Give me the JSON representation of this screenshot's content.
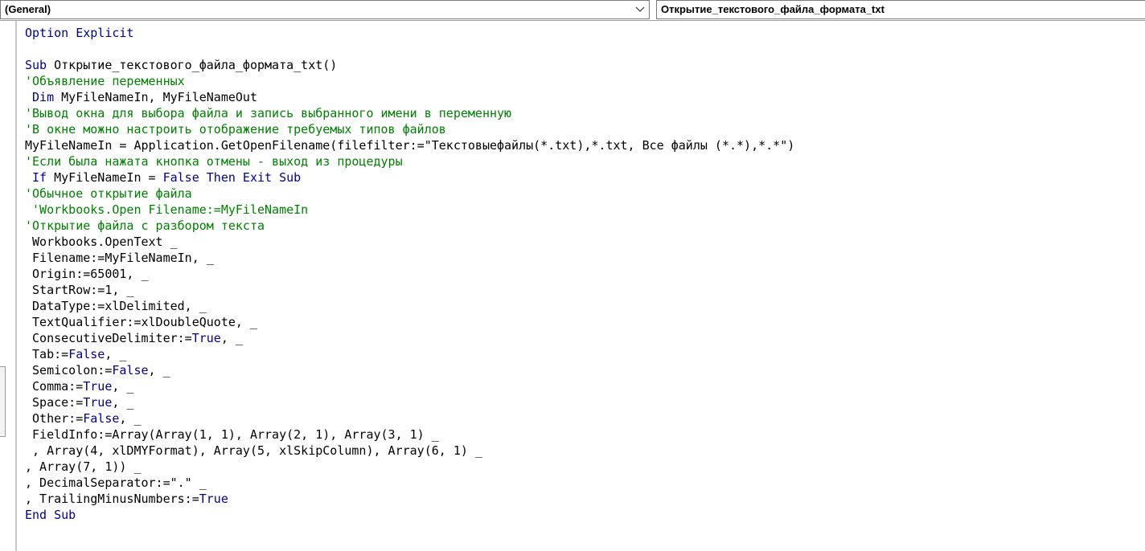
{
  "object_combo": {
    "selected": "(General)"
  },
  "procedure_combo": {
    "selected": "Открытие_текстового_файла_формата_txt"
  },
  "icons": {
    "dropdown": "chevron-down-icon"
  },
  "colors": {
    "keyword": "#00008b",
    "comment": "#008000",
    "text": "#000000"
  },
  "code_lines": [
    [
      {
        "t": "kw",
        "s": "Option Explicit"
      }
    ],
    [],
    [
      {
        "t": "kw",
        "s": "Sub"
      },
      {
        "t": "tx",
        "s": " Открытие_текстового_файла_формата_txt()"
      }
    ],
    [
      {
        "t": "cm",
        "s": "'Объявление переменных"
      }
    ],
    [
      {
        "t": "kw",
        "s": " Dim"
      },
      {
        "t": "tx",
        "s": " MyFileNameIn, MyFileNameOut"
      }
    ],
    [
      {
        "t": "cm",
        "s": "'Вывод окна для выбора файла и запись выбранного имени в переменную"
      }
    ],
    [
      {
        "t": "cm",
        "s": "'В окне можно настроить отображение требуемых типов файлов"
      }
    ],
    [
      {
        "t": "tx",
        "s": "MyFileNameIn = Application.GetOpenFilename(filefilter:=\"Текстовыефайлы(*.txt),*.txt, Все файлы (*.*),*.*\")"
      }
    ],
    [
      {
        "t": "cm",
        "s": "'Если была нажата кнопка отмены - выход из процедуры"
      }
    ],
    [
      {
        "t": "kw",
        "s": " If"
      },
      {
        "t": "tx",
        "s": " MyFileNameIn = "
      },
      {
        "t": "kw",
        "s": "False Then Exit Sub"
      }
    ],
    [
      {
        "t": "cm",
        "s": "'Обычное открытие файла"
      }
    ],
    [
      {
        "t": "cm",
        "s": " 'Workbooks.Open Filename:=MyFileNameIn"
      }
    ],
    [
      {
        "t": "cm",
        "s": "'Открытие файла с разбором текста"
      }
    ],
    [
      {
        "t": "tx",
        "s": " Workbooks.OpenText _"
      }
    ],
    [
      {
        "t": "tx",
        "s": " Filename:=MyFileNameIn, _"
      }
    ],
    [
      {
        "t": "tx",
        "s": " Origin:=65001, _"
      }
    ],
    [
      {
        "t": "tx",
        "s": " StartRow:=1, _"
      }
    ],
    [
      {
        "t": "tx",
        "s": " DataType:=xlDelimited, _"
      }
    ],
    [
      {
        "t": "tx",
        "s": " TextQualifier:=xlDoubleQuote, _"
      }
    ],
    [
      {
        "t": "tx",
        "s": " ConsecutiveDelimiter:="
      },
      {
        "t": "kw",
        "s": "True"
      },
      {
        "t": "tx",
        "s": ", _"
      }
    ],
    [
      {
        "t": "tx",
        "s": " Tab:="
      },
      {
        "t": "kw",
        "s": "False"
      },
      {
        "t": "tx",
        "s": ", _"
      }
    ],
    [
      {
        "t": "tx",
        "s": " Semicolon:="
      },
      {
        "t": "kw",
        "s": "False"
      },
      {
        "t": "tx",
        "s": ", _"
      }
    ],
    [
      {
        "t": "tx",
        "s": " Comma:="
      },
      {
        "t": "kw",
        "s": "True"
      },
      {
        "t": "tx",
        "s": ", _"
      }
    ],
    [
      {
        "t": "tx",
        "s": " Space:="
      },
      {
        "t": "kw",
        "s": "True"
      },
      {
        "t": "tx",
        "s": ", _"
      }
    ],
    [
      {
        "t": "tx",
        "s": " Other:="
      },
      {
        "t": "kw",
        "s": "False"
      },
      {
        "t": "tx",
        "s": ", _"
      }
    ],
    [
      {
        "t": "tx",
        "s": " FieldInfo:=Array(Array(1, 1), Array(2, 1), Array(3, 1) _"
      }
    ],
    [
      {
        "t": "tx",
        "s": " , Array(4, xlDMYFormat), Array(5, xlSkipColumn), Array(6, 1) _"
      }
    ],
    [
      {
        "t": "tx",
        "s": ", Array(7, 1)) _"
      }
    ],
    [
      {
        "t": "tx",
        "s": ", DecimalSeparator:=\".\" _"
      }
    ],
    [
      {
        "t": "tx",
        "s": ", TrailingMinusNumbers:="
      },
      {
        "t": "kw",
        "s": "True"
      }
    ],
    [
      {
        "t": "kw",
        "s": "End Sub"
      }
    ]
  ]
}
